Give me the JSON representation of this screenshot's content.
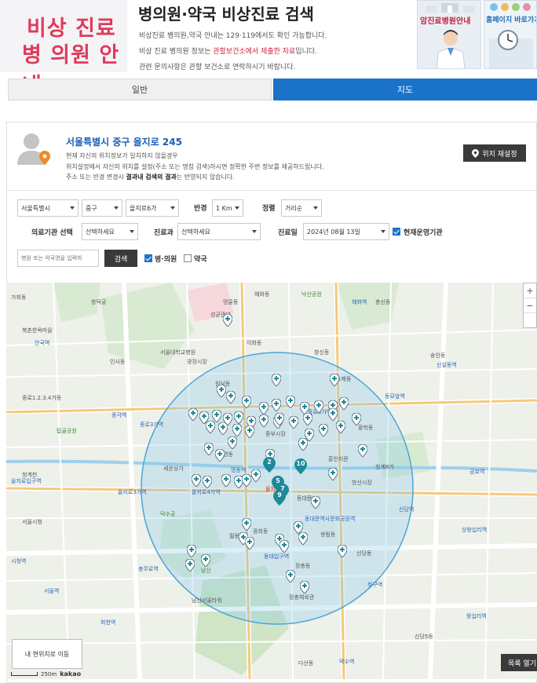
{
  "header": {
    "logo_line1": "비상 진료",
    "logo_line2": "병 의원 안내",
    "title": "병의원·약국 비상진료 검색",
    "notice1": "비상진료 병의원,약국 안내는 129·119에서도 확인 가능합니다.",
    "notice2_pre": "비상 진료 병의원 정보는 ",
    "notice2_hl": "관할보건소에서 제출한 자료",
    "notice2_post": "입니다.",
    "notice3": "관련 문의사항은 관할 보건소로 연락하시기 바랍니다.",
    "banner1_label": "암진료병원안내",
    "banner2_label": "홈페이지 바로가기"
  },
  "tabs": [
    {
      "label": "일반",
      "active": false
    },
    {
      "label": "지도",
      "active": true
    }
  ],
  "location": {
    "address": "서울특별시 중구 을지로 245",
    "desc1": "현재 자신의 위치정보가 일치하지 않을경우",
    "desc2": "위치설정에서 자신의 위치를 설정(주소 또는 명칭 검색)하시면 정확한 주변 정보를 제공하드립니다.",
    "desc3_pre": "주소 또는 반경 변경시 ",
    "desc3_bold": "결과내 검색의 결과",
    "desc3_post": "는 반영되지 않습니다.",
    "reset_label": "위치 재설정"
  },
  "filters": {
    "sido": "서울특별시",
    "gu": "중구",
    "dong": "을지로6가",
    "radius_label": "반경",
    "radius": "1 Km",
    "sort_label": "정렬",
    "sort": "거리순",
    "inst_label": "의료기관 선택",
    "inst": "선택하세요",
    "dept_label": "진료과",
    "dept": "선택하세요",
    "date_label": "진료일",
    "date": "2024년 08월 13일",
    "open_now_label": "현재운영기관",
    "open_now": true,
    "search_placeholder": "병원 또는 약국명을 입력하",
    "search_button": "검색",
    "hospital_label": "병·의원",
    "hospital_checked": true,
    "pharmacy_label": "약국",
    "pharmacy_checked": false
  },
  "map": {
    "zoom_in": "+",
    "zoom_out": "−",
    "my_location_label": "내 현위치로 이동",
    "list_open_label": "목록 열기",
    "scale_label": "250m",
    "provider": "kakao",
    "labels": [
      "가회동",
      "창덕궁",
      "북촌한옥마을",
      "인사동",
      "안국역",
      "종로1.2.3.4가동",
      "종각역",
      "종로3가역",
      "탑골공원",
      "을지로입구역",
      "을지로3가역",
      "청계천",
      "서울시청",
      "덕수궁",
      "시청역",
      "명동",
      "남산",
      "서울역",
      "회현역",
      "충무로역",
      "필동",
      "장충동",
      "동대입구역",
      "약수역",
      "신당역",
      "동대문역사문화공원역",
      "동대문",
      "창신동",
      "숭인동",
      "신설동역",
      "동묘앞역",
      "종로5가역",
      "혜화역",
      "이화동",
      "원남동",
      "효제동",
      "광희동",
      "을지로4가역",
      "세운상가",
      "명동역",
      "남산서울타워",
      "다산동",
      "청구역",
      "신당동",
      "황학동",
      "청계8가",
      "충신동",
      "낙산공원",
      "혜화동",
      "명륜동",
      "성균관대",
      "서울대학교병원",
      "방산시장",
      "중부시장",
      "광장시장",
      "을지로6가",
      "쌍림동",
      "장충체육관",
      "흥인지문",
      "왕십리역",
      "상왕십리역",
      "신당5동",
      "금호역"
    ],
    "cluster_numbers": [
      "2",
      "5",
      "7",
      "9",
      "10"
    ]
  }
}
